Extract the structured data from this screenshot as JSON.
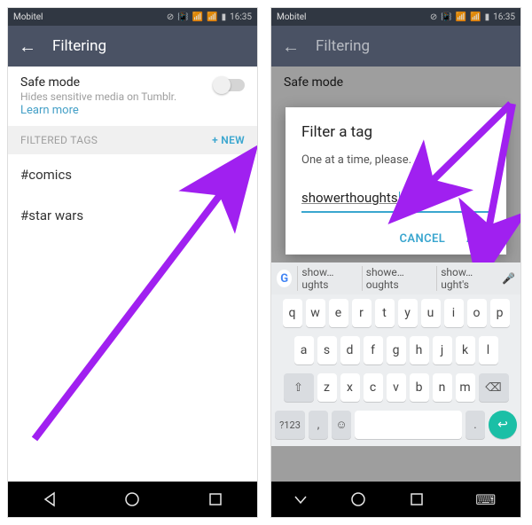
{
  "status": {
    "carrier": "Mobitel",
    "time": "16:35"
  },
  "appbar": {
    "title": "Filtering"
  },
  "safe_mode": {
    "title": "Safe mode",
    "desc": "Hides sensitive media on Tumblr.",
    "learn": "Learn more"
  },
  "section": {
    "header": "FILTERED TAGS",
    "new": "+ NEW"
  },
  "tags": [
    "#comics",
    "#star wars"
  ],
  "dialog": {
    "title": "Filter a tag",
    "subtitle": "One at a time, please.",
    "value": "showerthoughts",
    "cancel": "CANCEL",
    "add": "ADD"
  },
  "keyboard": {
    "suggestions": [
      "show…ughts",
      "showe…oughts",
      "show…ught's"
    ],
    "row1": [
      "q",
      "w",
      "e",
      "r",
      "t",
      "y",
      "u",
      "i",
      "o",
      "p"
    ],
    "row2": [
      "a",
      "s",
      "d",
      "f",
      "g",
      "h",
      "j",
      "k",
      "l"
    ],
    "row3_mid": [
      "z",
      "x",
      "c",
      "v",
      "b",
      "n",
      "m"
    ],
    "numkey": "?123"
  }
}
